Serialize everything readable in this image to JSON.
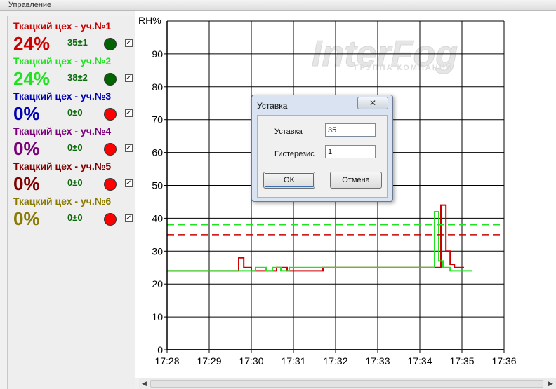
{
  "menubar": {
    "label": "Управление"
  },
  "zones": [
    {
      "title": "Ткацкий цех - уч.№1",
      "value": "24%",
      "setpoint": "35±1",
      "color": "#cc0000",
      "led": "#006400",
      "checked": true
    },
    {
      "title": "Ткацкий цех - уч.№2",
      "value": "24%",
      "setpoint": "38±2",
      "color": "#22e022",
      "led": "#006400",
      "checked": true
    },
    {
      "title": "Ткацкий цех - уч.№3",
      "value": "0%",
      "setpoint": "0±0",
      "color": "#0000b4",
      "led": "#ff0000",
      "checked": true
    },
    {
      "title": "Ткацкий цех - уч.№4",
      "value": "0%",
      "setpoint": "0±0",
      "color": "#7a007a",
      "led": "#ff0000",
      "checked": true
    },
    {
      "title": "Ткацкий цех - уч.№5",
      "value": "0%",
      "setpoint": "0±0",
      "color": "#800000",
      "led": "#ff0000",
      "checked": true
    },
    {
      "title": "Ткацкий цех - уч.№6",
      "value": "0%",
      "setpoint": "0±0",
      "color": "#8a7a00",
      "led": "#ff0000",
      "checked": true
    }
  ],
  "watermark": {
    "brand": "InterFog",
    "tagline": "ГРУППА КОМПАНИЙ"
  },
  "chart_data": {
    "type": "line",
    "ylabel": "RH%",
    "ylim": [
      0,
      100
    ],
    "yticks": [
      0,
      10,
      20,
      30,
      40,
      50,
      60,
      70,
      80,
      90
    ],
    "x_tick_labels": [
      "17:28",
      "17:29",
      "17:30",
      "17:31",
      "17:32",
      "17:33",
      "17:34",
      "17:35",
      "17:36"
    ],
    "xlim_minutes": [
      0,
      8
    ],
    "grid": true,
    "series": [
      {
        "color": "#cc0000",
        "points": [
          [
            0,
            24
          ],
          [
            1.7,
            24
          ],
          [
            1.7,
            28
          ],
          [
            1.82,
            28
          ],
          [
            1.82,
            25
          ],
          [
            2.0,
            25
          ],
          [
            2.0,
            24
          ],
          [
            2.6,
            24
          ],
          [
            2.6,
            25
          ],
          [
            2.85,
            25
          ],
          [
            2.85,
            24
          ],
          [
            3.7,
            24
          ],
          [
            3.7,
            25
          ],
          [
            4.35,
            25
          ],
          [
            4.35,
            25
          ],
          [
            6.5,
            25
          ],
          [
            6.5,
            44
          ],
          [
            6.62,
            44
          ],
          [
            6.62,
            30
          ],
          [
            6.72,
            30
          ],
          [
            6.72,
            26
          ],
          [
            6.82,
            26
          ],
          [
            6.82,
            25
          ],
          [
            7.05,
            25
          ]
        ]
      },
      {
        "color": "#22e022",
        "points": [
          [
            0,
            24
          ],
          [
            2.1,
            24
          ],
          [
            2.1,
            25
          ],
          [
            2.35,
            25
          ],
          [
            2.35,
            24
          ],
          [
            2.5,
            24
          ],
          [
            2.5,
            25
          ],
          [
            2.7,
            25
          ],
          [
            2.7,
            24
          ],
          [
            2.9,
            24
          ],
          [
            2.9,
            25
          ],
          [
            4.35,
            25
          ],
          [
            6.35,
            25
          ],
          [
            6.35,
            42
          ],
          [
            6.45,
            42
          ],
          [
            6.45,
            27
          ],
          [
            6.55,
            27
          ],
          [
            6.55,
            25
          ],
          [
            6.72,
            25
          ],
          [
            6.72,
            24
          ],
          [
            7.25,
            24
          ]
        ]
      },
      {
        "color": "#cc0000",
        "dashed": true,
        "points": [
          [
            0,
            35
          ],
          [
            8,
            35
          ]
        ]
      },
      {
        "color": "#22e022",
        "dashed": true,
        "points": [
          [
            0,
            38
          ],
          [
            8,
            38
          ]
        ]
      },
      {
        "color": "#8a7a00",
        "points": [
          [
            0,
            0
          ],
          [
            8,
            0
          ]
        ]
      }
    ]
  },
  "dialog": {
    "title": "Уставка",
    "close_glyph": "✕",
    "setpoint_label": "Уставка",
    "setpoint_value": "35",
    "hysteresis_label": "Гистерезис",
    "hysteresis_value": "1",
    "ok_label": "OK",
    "cancel_label": "Отмена"
  },
  "scrollbar": {
    "left_arrow": "◀",
    "right_arrow": "▶"
  }
}
